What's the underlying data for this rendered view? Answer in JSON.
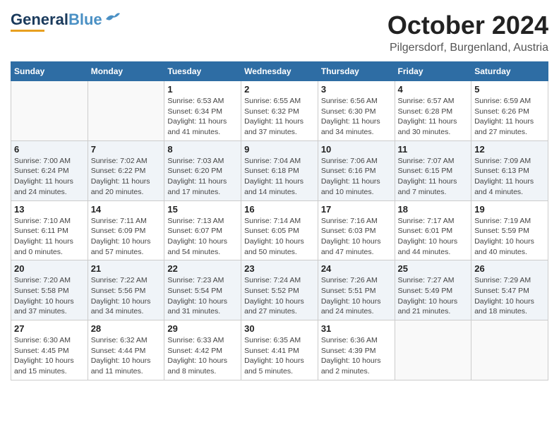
{
  "header": {
    "logo_general": "General",
    "logo_blue": "Blue",
    "month_title": "October 2024",
    "location": "Pilgersdorf, Burgenland, Austria"
  },
  "days_of_week": [
    "Sunday",
    "Monday",
    "Tuesday",
    "Wednesday",
    "Thursday",
    "Friday",
    "Saturday"
  ],
  "weeks": [
    [
      {
        "day": "",
        "info": ""
      },
      {
        "day": "",
        "info": ""
      },
      {
        "day": "1",
        "info": "Sunrise: 6:53 AM\nSunset: 6:34 PM\nDaylight: 11 hours and 41 minutes."
      },
      {
        "day": "2",
        "info": "Sunrise: 6:55 AM\nSunset: 6:32 PM\nDaylight: 11 hours and 37 minutes."
      },
      {
        "day": "3",
        "info": "Sunrise: 6:56 AM\nSunset: 6:30 PM\nDaylight: 11 hours and 34 minutes."
      },
      {
        "day": "4",
        "info": "Sunrise: 6:57 AM\nSunset: 6:28 PM\nDaylight: 11 hours and 30 minutes."
      },
      {
        "day": "5",
        "info": "Sunrise: 6:59 AM\nSunset: 6:26 PM\nDaylight: 11 hours and 27 minutes."
      }
    ],
    [
      {
        "day": "6",
        "info": "Sunrise: 7:00 AM\nSunset: 6:24 PM\nDaylight: 11 hours and 24 minutes."
      },
      {
        "day": "7",
        "info": "Sunrise: 7:02 AM\nSunset: 6:22 PM\nDaylight: 11 hours and 20 minutes."
      },
      {
        "day": "8",
        "info": "Sunrise: 7:03 AM\nSunset: 6:20 PM\nDaylight: 11 hours and 17 minutes."
      },
      {
        "day": "9",
        "info": "Sunrise: 7:04 AM\nSunset: 6:18 PM\nDaylight: 11 hours and 14 minutes."
      },
      {
        "day": "10",
        "info": "Sunrise: 7:06 AM\nSunset: 6:16 PM\nDaylight: 11 hours and 10 minutes."
      },
      {
        "day": "11",
        "info": "Sunrise: 7:07 AM\nSunset: 6:15 PM\nDaylight: 11 hours and 7 minutes."
      },
      {
        "day": "12",
        "info": "Sunrise: 7:09 AM\nSunset: 6:13 PM\nDaylight: 11 hours and 4 minutes."
      }
    ],
    [
      {
        "day": "13",
        "info": "Sunrise: 7:10 AM\nSunset: 6:11 PM\nDaylight: 11 hours and 0 minutes."
      },
      {
        "day": "14",
        "info": "Sunrise: 7:11 AM\nSunset: 6:09 PM\nDaylight: 10 hours and 57 minutes."
      },
      {
        "day": "15",
        "info": "Sunrise: 7:13 AM\nSunset: 6:07 PM\nDaylight: 10 hours and 54 minutes."
      },
      {
        "day": "16",
        "info": "Sunrise: 7:14 AM\nSunset: 6:05 PM\nDaylight: 10 hours and 50 minutes."
      },
      {
        "day": "17",
        "info": "Sunrise: 7:16 AM\nSunset: 6:03 PM\nDaylight: 10 hours and 47 minutes."
      },
      {
        "day": "18",
        "info": "Sunrise: 7:17 AM\nSunset: 6:01 PM\nDaylight: 10 hours and 44 minutes."
      },
      {
        "day": "19",
        "info": "Sunrise: 7:19 AM\nSunset: 5:59 PM\nDaylight: 10 hours and 40 minutes."
      }
    ],
    [
      {
        "day": "20",
        "info": "Sunrise: 7:20 AM\nSunset: 5:58 PM\nDaylight: 10 hours and 37 minutes."
      },
      {
        "day": "21",
        "info": "Sunrise: 7:22 AM\nSunset: 5:56 PM\nDaylight: 10 hours and 34 minutes."
      },
      {
        "day": "22",
        "info": "Sunrise: 7:23 AM\nSunset: 5:54 PM\nDaylight: 10 hours and 31 minutes."
      },
      {
        "day": "23",
        "info": "Sunrise: 7:24 AM\nSunset: 5:52 PM\nDaylight: 10 hours and 27 minutes."
      },
      {
        "day": "24",
        "info": "Sunrise: 7:26 AM\nSunset: 5:51 PM\nDaylight: 10 hours and 24 minutes."
      },
      {
        "day": "25",
        "info": "Sunrise: 7:27 AM\nSunset: 5:49 PM\nDaylight: 10 hours and 21 minutes."
      },
      {
        "day": "26",
        "info": "Sunrise: 7:29 AM\nSunset: 5:47 PM\nDaylight: 10 hours and 18 minutes."
      }
    ],
    [
      {
        "day": "27",
        "info": "Sunrise: 6:30 AM\nSunset: 4:45 PM\nDaylight: 10 hours and 15 minutes."
      },
      {
        "day": "28",
        "info": "Sunrise: 6:32 AM\nSunset: 4:44 PM\nDaylight: 10 hours and 11 minutes."
      },
      {
        "day": "29",
        "info": "Sunrise: 6:33 AM\nSunset: 4:42 PM\nDaylight: 10 hours and 8 minutes."
      },
      {
        "day": "30",
        "info": "Sunrise: 6:35 AM\nSunset: 4:41 PM\nDaylight: 10 hours and 5 minutes."
      },
      {
        "day": "31",
        "info": "Sunrise: 6:36 AM\nSunset: 4:39 PM\nDaylight: 10 hours and 2 minutes."
      },
      {
        "day": "",
        "info": ""
      },
      {
        "day": "",
        "info": ""
      }
    ]
  ]
}
